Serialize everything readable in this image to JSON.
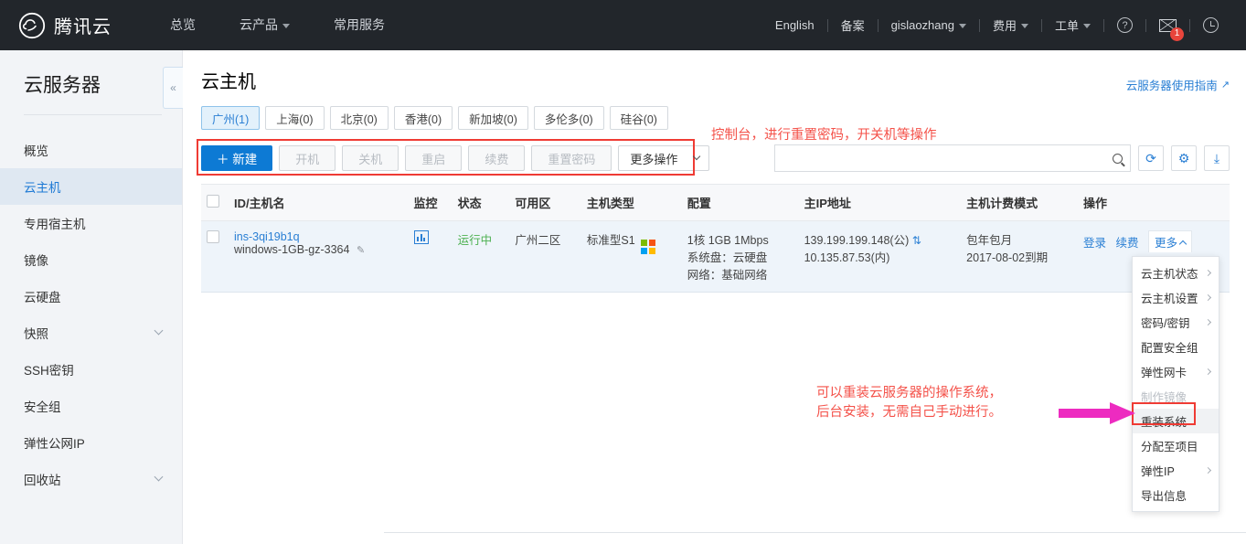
{
  "header": {
    "brand": "腾讯云",
    "brand_icon": "cloud-logo-icon",
    "nav": [
      {
        "label": "总览",
        "caret": false
      },
      {
        "label": "云产品",
        "caret": true
      },
      {
        "label": "常用服务",
        "caret": false
      }
    ],
    "right_nav": [
      {
        "label": "English",
        "caret": false
      },
      {
        "label": "备案",
        "caret": false
      },
      {
        "label": "gislaozhang",
        "caret": true
      },
      {
        "label": "费用",
        "caret": true
      },
      {
        "label": "工单",
        "caret": true
      }
    ],
    "help_icon": "question-mark-icon",
    "mail_icon": "mail-icon",
    "mail_badge": "1",
    "clock_icon": "clock-icon"
  },
  "sidebar": {
    "title": "云服务器",
    "collapse_icon": "chevron-double-left-icon",
    "items": [
      {
        "label": "概览",
        "active": false,
        "expandable": false
      },
      {
        "label": "云主机",
        "active": true,
        "expandable": false
      },
      {
        "label": "专用宿主机",
        "active": false,
        "expandable": false
      },
      {
        "label": "镜像",
        "active": false,
        "expandable": false
      },
      {
        "label": "云硬盘",
        "active": false,
        "expandable": false
      },
      {
        "label": "快照",
        "active": false,
        "expandable": true
      },
      {
        "label": "SSH密钥",
        "active": false,
        "expandable": false
      },
      {
        "label": "安全组",
        "active": false,
        "expandable": false
      },
      {
        "label": "弹性公网IP",
        "active": false,
        "expandable": false
      },
      {
        "label": "回收站",
        "active": false,
        "expandable": true
      }
    ]
  },
  "page": {
    "title": "云主机",
    "guide_link": "云服务器使用指南",
    "guide_icon": "external-link-icon"
  },
  "region_tabs": [
    {
      "label": "广州(1)",
      "active": true
    },
    {
      "label": "上海(0)",
      "active": false
    },
    {
      "label": "北京(0)",
      "active": false
    },
    {
      "label": "香港(0)",
      "active": false
    },
    {
      "label": "新加坡(0)",
      "active": false
    },
    {
      "label": "多伦多(0)",
      "active": false
    },
    {
      "label": "硅谷(0)",
      "active": false
    }
  ],
  "toolbar": {
    "create_label": "＋ 新建",
    "buttons": [
      {
        "label": "开机",
        "disabled": true
      },
      {
        "label": "关机",
        "disabled": true
      },
      {
        "label": "重启",
        "disabled": true
      },
      {
        "label": "续费",
        "disabled": true
      },
      {
        "label": "重置密码",
        "disabled": true
      }
    ],
    "more_label": "更多操作",
    "more_icon": "chevron-down-icon",
    "search_value": "",
    "search_placeholder": "",
    "search_icon": "search-icon",
    "refresh_icon": "refresh-icon",
    "settings_icon": "gear-icon",
    "export_icon": "download-icon",
    "highlight_color": "#ef3b34"
  },
  "table": {
    "columns": [
      "ID/主机名",
      "监控",
      "状态",
      "可用区",
      "主机类型",
      "配置",
      "主IP地址",
      "主机计费模式",
      "操作"
    ],
    "rows": [
      {
        "id": "ins-3qi19b1q",
        "hostname": "windows-1GB-gz-3364",
        "edit_icon": "pencil-icon",
        "monitor_icon": "bar-chart-icon",
        "status": "运行中",
        "status_color": "#4cb050",
        "zone": "广州二区",
        "type": "标准型S1",
        "os_icon": "windows-logo-icon",
        "config": [
          "1核 1GB 1Mbps",
          "系统盘：云硬盘",
          "网络：基础网络"
        ],
        "ip_public": "139.199.199.148(公)",
        "ip_copy_icon": "copy-icon",
        "ip_private": "10.135.87.53(内)",
        "billing": [
          "包年包月",
          "2017-08-02到期"
        ],
        "actions": [
          "登录",
          "续费"
        ],
        "more_label": "更多",
        "more_icon": "chevron-up-icon"
      }
    ]
  },
  "dropdown": {
    "items": [
      {
        "label": "云主机状态",
        "submenu": true,
        "disabled": false,
        "highlight": false
      },
      {
        "label": "云主机设置",
        "submenu": true,
        "disabled": false,
        "highlight": false
      },
      {
        "label": "密码/密钥",
        "submenu": true,
        "disabled": false,
        "highlight": false
      },
      {
        "label": "配置安全组",
        "submenu": false,
        "disabled": false,
        "highlight": false
      },
      {
        "label": "弹性网卡",
        "submenu": true,
        "disabled": false,
        "highlight": false
      },
      {
        "label": "制作镜像",
        "submenu": false,
        "disabled": true,
        "highlight": false
      },
      {
        "label": "重装系统",
        "submenu": false,
        "disabled": false,
        "highlight": true
      },
      {
        "label": "分配至项目",
        "submenu": false,
        "disabled": false,
        "highlight": false
      },
      {
        "label": "弹性IP",
        "submenu": true,
        "disabled": false,
        "highlight": false
      },
      {
        "label": "导出信息",
        "submenu": false,
        "disabled": false,
        "highlight": false
      }
    ],
    "highlight_color": "#ef3b34"
  },
  "annotations": {
    "color": "#f4524a",
    "note1": "控制台，进行重置密码，开关机等操作",
    "note2": "可以重装云服务器的操作系统，\n后台安装，无需自己手动进行。",
    "arrow_color": "#ed2bc0",
    "arrow_icon": "arrow-right-icon"
  }
}
